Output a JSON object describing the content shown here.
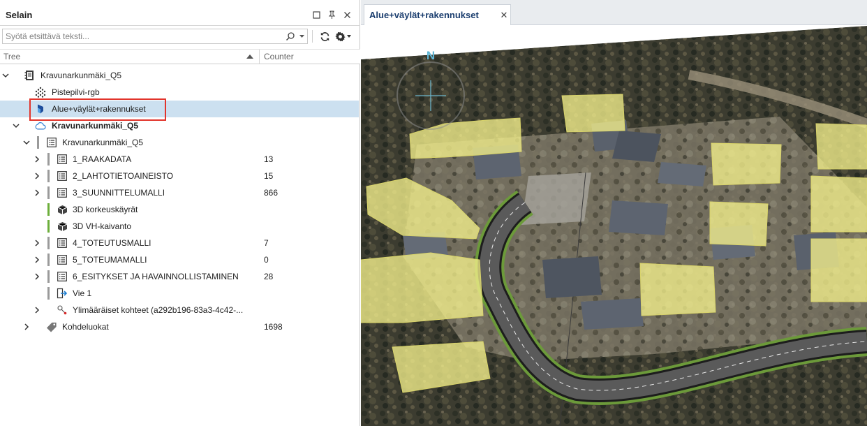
{
  "panel": {
    "title": "Selain"
  },
  "search": {
    "placeholder": "Syötä etsittävä teksti..."
  },
  "columns": {
    "tree": "Tree",
    "counter": "Counter"
  },
  "tree": [
    {
      "label": "Kravunarkunmäki_Q5",
      "counter": "",
      "icon": "notebook-icon",
      "bold": false
    },
    {
      "label": "Pistepilvi-rgb",
      "counter": "",
      "icon": "point-cloud-icon",
      "bold": false
    },
    {
      "label": "Alue+väylät+rakennukset",
      "counter": "",
      "icon": "model-logo-icon",
      "bold": false
    },
    {
      "label": "Kravunarkunmäki_Q5",
      "counter": "",
      "icon": "cloud-icon",
      "bold": true
    },
    {
      "label": "Kravunarkunmäki_Q5",
      "counter": "",
      "icon": "list-icon",
      "bold": false
    },
    {
      "label": "1_RAAKADATA",
      "counter": "13",
      "icon": "list-icon",
      "bold": false
    },
    {
      "label": "2_LAHTOTIETOAINEISTO",
      "counter": "15",
      "icon": "list-icon",
      "bold": false
    },
    {
      "label": "3_SUUNNITTELUMALLI",
      "counter": "866",
      "icon": "list-icon",
      "bold": false
    },
    {
      "label": "3D korkeuskäyrät",
      "counter": "",
      "icon": "cube-icon",
      "bold": false
    },
    {
      "label": "3D VH-kaivanto",
      "counter": "",
      "icon": "cube-icon",
      "bold": false
    },
    {
      "label": "4_TOTEUTUSMALLI",
      "counter": "7",
      "icon": "list-icon",
      "bold": false
    },
    {
      "label": "5_TOTEUMAMALLI",
      "counter": "0",
      "icon": "list-icon",
      "bold": false
    },
    {
      "label": "6_ESITYKSET JA HAVAINNOLLISTAMINEN",
      "counter": "28",
      "icon": "list-icon",
      "bold": false
    },
    {
      "label": "Vie 1",
      "counter": "",
      "icon": "export-icon",
      "bold": false
    },
    {
      "label": "Ylimääräiset kohteet (a292b196-83a3-4c42-...",
      "counter": "",
      "icon": "extra-objects-icon",
      "bold": false
    },
    {
      "label": "Kohdeluokat",
      "counter": "1698",
      "icon": "tag-icon",
      "bold": false
    }
  ],
  "viewer": {
    "tab_label": "Alue+väylät+rakennukset",
    "compass_label": "N"
  },
  "colors": {
    "selection": "#cce0f0",
    "highlight_border": "#e2342b",
    "building": "#f3f08c",
    "road": "#5a5a5a",
    "road_edge": "#6c9a3a"
  }
}
